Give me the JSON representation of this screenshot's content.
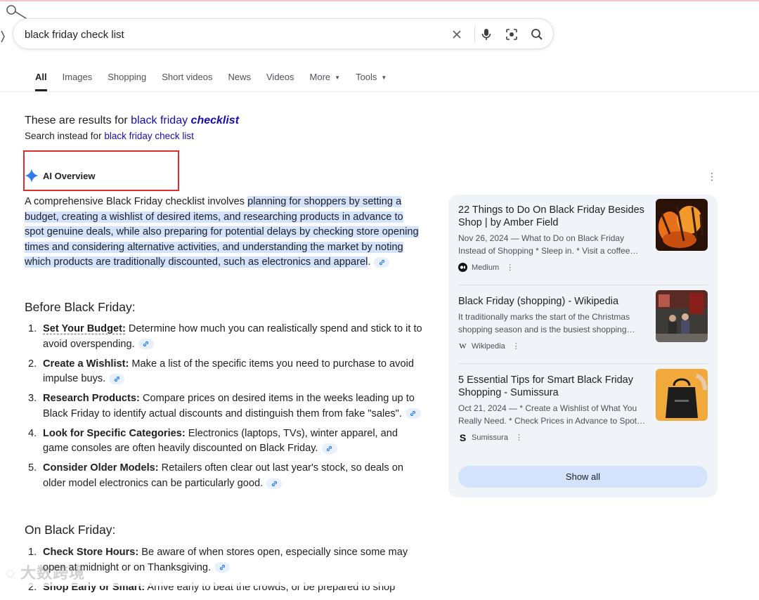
{
  "search": {
    "query": "black friday check list"
  },
  "tabs": [
    {
      "label": "All"
    },
    {
      "label": "Images"
    },
    {
      "label": "Shopping"
    },
    {
      "label": "Short videos"
    },
    {
      "label": "News"
    },
    {
      "label": "Videos"
    },
    {
      "label": "More"
    },
    {
      "label": "Tools"
    }
  ],
  "correction": {
    "prefix": "These are results for ",
    "corrected_plain": "black friday ",
    "corrected_bold": "checklist",
    "instead_prefix": "Search instead for ",
    "instead_link": "black friday check list"
  },
  "ai_overview": {
    "label": "AI Overview",
    "intro_plain": "A comprehensive Black Friday checklist involves ",
    "intro_highlight": "planning for shoppers by setting a budget, creating a wishlist of desired items, and researching products in advance to spot genuine deals, while also preparing for potential delays by checking store opening times and considering alternative activities, and understanding the market by noting which products are traditionally discounted, such as electronics and apparel",
    "intro_end": ".",
    "sections": [
      {
        "heading": "Before Black Friday:",
        "items": [
          {
            "num": "1.",
            "title": "Set Your Budget:",
            "text": " Determine how much you can realistically spend and stick to it to avoid overspending."
          },
          {
            "num": "2.",
            "title": "Create a Wishlist:",
            "text": " Make a list of the specific items you need to purchase to avoid impulse buys."
          },
          {
            "num": "3.",
            "title": "Research Products:",
            "text": " Compare prices on desired items in the weeks leading up to Black Friday to identify actual discounts and distinguish them from fake \"sales\"."
          },
          {
            "num": "4.",
            "title": "Look for Specific Categories:",
            "text": " Electronics (laptops, TVs), winter apparel, and game consoles are often heavily discounted on Black Friday."
          },
          {
            "num": "5.",
            "title": "Consider Older Models:",
            "text": " Retailers often clear out last year's stock, so deals on older model electronics can be particularly good."
          }
        ]
      },
      {
        "heading": "On Black Friday:",
        "items": [
          {
            "num": "1.",
            "title": "Check Store Hours:",
            "text": " Be aware of when stores open, especially since some may open at midnight or on Thanksgiving."
          },
          {
            "num": "2.",
            "title": "Shop Early or Smart:",
            "text": " Arrive early to beat the crowds, or be prepared to shop"
          }
        ]
      }
    ]
  },
  "sources": [
    {
      "title": "22 Things to Do On Black Friday Besides Shop | by Amber Field",
      "snippet": "Nov 26, 2024 — What to Do on Black Friday Instead of Shopping * Sleep in. * Visit a coffee…",
      "site": "Medium"
    },
    {
      "title": "Black Friday (shopping) - Wikipedia",
      "snippet": "It traditionally marks the start of the Christmas shopping season and is the busiest shopping…",
      "site": "Wikipedia"
    },
    {
      "title": "5 Essential Tips for Smart Black Friday Shopping - Sumissura",
      "snippet": "Oct 21, 2024 — * Create a Wishlist of What You Really Need. * Check Prices in Advance to Spot…",
      "site": "Sumissura"
    }
  ],
  "show_all_label": "Show all",
  "colors": {
    "link": "#1a0dab",
    "highlight": "#d3e3fd",
    "panel_bg": "#f0f4f9",
    "annotation_box": "#e32b2b"
  }
}
